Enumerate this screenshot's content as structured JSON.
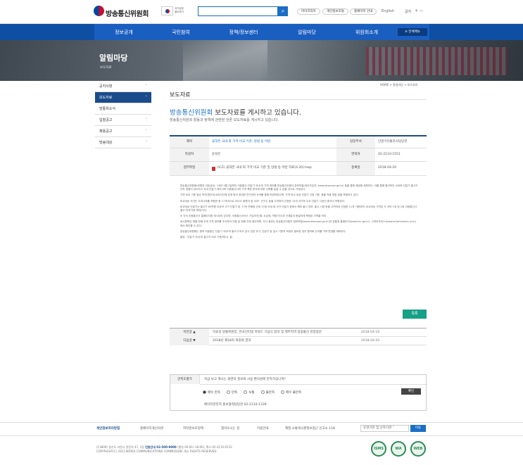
{
  "header": {
    "site_name": "방송통신위원회",
    "gov_line1": "국가상징",
    "gov_line2": "알아보기",
    "search_placeholder": "",
    "util_buttons": [
      "마이코리아",
      "개인정보포털",
      "홈페이지 안내"
    ],
    "language": "English",
    "font_size_label": "글자",
    "font_plus": "+",
    "font_minus": "−"
  },
  "nav": {
    "items": [
      "정보공개",
      "국민참여",
      "정책/정보센터",
      "알림마당",
      "위원회소개"
    ],
    "all_menu": "≡ 전체메뉴"
  },
  "hero": {
    "title": "알림마당",
    "subtitle": "보도자료"
  },
  "sidebar": {
    "items": [
      {
        "label": "공지사항",
        "active": false
      },
      {
        "label": "보도자료",
        "active": true
      },
      {
        "label": "방통위소식",
        "active": false
      },
      {
        "label": "입찰공고",
        "active": false
      },
      {
        "label": "채용공고",
        "active": false
      },
      {
        "label": "방송대상",
        "active": false
      }
    ]
  },
  "content": {
    "title": "보도자료",
    "breadcrumb": "HOME  >  알림마당  >  보도자료",
    "headline_highlight": "방송통신위원회",
    "headline_rest": " 보도자료를 게시하고 있습니다.",
    "subline": "방송통신위원회 활동과 정책에 관련된 언론 보도자료를 게시하고 있습니다."
  },
  "detail": {
    "title_label": "제목",
    "title_value": "휴대폰 국내·외 가격 비교 기준, 방법 등 마련",
    "dept_label": "담당부서",
    "dept_value": "단말기유통조사담당관",
    "author_label": "작성자",
    "author_value": "윤성은",
    "contact_label": "연락처",
    "contact_value": "02-2110-1551",
    "file_label": "첨부파일",
    "file_value": "(보고) 휴대폰 국내·외 가격 비교 기준 및 방법 등 마련 자료(4.20).hwp",
    "date_label": "등록일",
    "date_value": "2018-04-20"
  },
  "body": {
    "paragraphs": [
      "방송통신위원회(위원장 이효성)는 '18년 5월 2일부터 이동통신 단말기 국내·외 가격 정보를 방송통신이용자 정보포털(와이즈유저, www.wiseuser.go.kr) 등을 통해 제공할 계획이다. 이를 통해 합리적인 소비와 단말기 출고가 인하 경쟁이 유도되고 국내 단말기 제조사와 이동통신사의 가격 책정 방식에 대한 신뢰를 높일 수 있을 것으로 기대된다.",
      "가격 비교 기준 등은 학계·법조계·소비자단체·업계 등이 참여한 연구반의 논의를 통해 마련하였으며, 가격 비교 대상 단말기 선정 기준, 환율 적용 방법 등을 포함하고 있다.",
      "비교대상 국가는 우리나라를 포함한 총 17개국으로 OECD 회원국 중 GDP, 인구수 등을 고려하여 선정한 15개 국가와 주요 단말기 시장인 중국이 포함된다.",
      "비교대상 단말기는 출고가 80만원 이상의 고가 단말기 및 '17년 판매량 순위 15위 이내 중 국가 단말기 중에서 해외 출시 여부, 출시 시점 등을 고려하여 선정한 11개 기종이며, 비교대상 가격은 각 국의 1위 및 2위 이동통신사 출고가(부가세 제외)이다.",
      "※ 각국 이동통신사 홈페이지에 게시되어 있으며, 이동통신서비스 가입조건(예: 요금제, 약정기간)과 관계없이 동일하게 책정된 가격을 의미",
      "공시항목은 매월 첫째 주에 가격 정보를 조사하여 다음 달 첫째 주에 갱신하며, 조사 결과는 방송통신이용자 정보포털(www.wiseuser.go.kr)과 방통위 홈페이지(www.kcc.go.kr), 스마트초이스(www.smartchoice.or.kr)에서 확인할 수 있다.",
      "방송통신위원회는 향후 이동통신 단말기 국내·외 출고가 비교 공시 관련 국가, 단말기 등 공시 기준의 보완이 필요한 경우 협의회 논의를 거쳐 변경할 계획이다.",
      "붙임 : 단말기 국내·외 출고가 비교 기준(예시). 끝."
    ]
  },
  "list_button": "목록",
  "prevnext": {
    "prev_label": "이전글 ▲",
    "prev_title": "이효성 방통위원장, 한국인터넷 어워드 기념식 참석 및 제주지역 방송통신 현장방문",
    "prev_date": "2018-04-16",
    "next_label": "다음글 ▼",
    "next_title": "2018년 제18차 위원회 결과",
    "next_date": "2018-04-20"
  },
  "survey": {
    "label": "만족도평가",
    "question": "지금 보고 계시는 화면의 정보와 사용 편의성에 만족하십니까?",
    "options": [
      "매우 만족",
      "만족",
      "보통",
      "불만족",
      "매우 불만족"
    ],
    "selected": 0,
    "submit": "확인",
    "contact": "페이지관리자 홍보협력담당관  02-2110-1339"
  },
  "footer": {
    "links": [
      "개인정보처리방침",
      "홈페이지개선의견",
      "저작권보호정책",
      "찾아오시는 길",
      "이용안내",
      "제정·소통게시판정보접근 신고소 118"
    ],
    "select_label": "유관기관 및 산하기관",
    "go": "이동",
    "addr_line1_pre": "(13809) 경기도 과천시 관문로 47, 2동 ",
    "addr_tel": "민원안내 02-500-9000",
    "addr_line1_post": " (평일 09:00~18:00), 팩스:02-2110-0153",
    "addr_line2": "COPYRIGHT(C) 2013 KOREA COMMUNICATIONS COMMISSION. ALL RIGHTS RESERVED.",
    "badges": [
      "ISMS",
      "WA",
      "WEB"
    ]
  },
  "colors": {
    "brand_blue": "#1a4c8b",
    "accent_blue": "#1a6fc4",
    "list_button": "#16a085"
  }
}
